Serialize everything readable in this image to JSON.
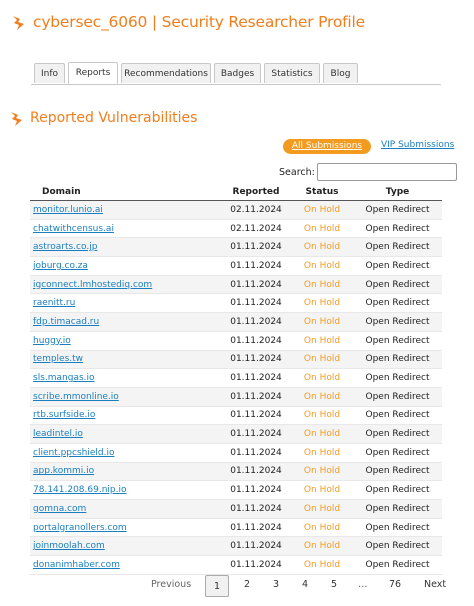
{
  "header": {
    "title": "cybersec_6060 | Security Researcher Profile"
  },
  "tabs": [
    {
      "label": "Info"
    },
    {
      "label": "Reports",
      "active": true
    },
    {
      "label": "Recommendations"
    },
    {
      "label": "Badges"
    },
    {
      "label": "Statistics"
    },
    {
      "label": "Blog"
    }
  ],
  "section": {
    "title": "Reported Vulnerabilities"
  },
  "filters": {
    "all_label": "All Submissions",
    "vip_label": "VIP Submissions"
  },
  "search": {
    "label": "Search:",
    "value": ""
  },
  "table": {
    "headers": {
      "domain": "Domain",
      "reported": "Reported",
      "status": "Status",
      "type": "Type"
    },
    "rows": [
      {
        "domain": "monitor.lunio.ai",
        "reported": "02.11.2024",
        "status": "On Hold",
        "type": "Open Redirect"
      },
      {
        "domain": "chatwithcensus.ai",
        "reported": "02.11.2024",
        "status": "On Hold",
        "type": "Open Redirect"
      },
      {
        "domain": "astroarts.co.jp",
        "reported": "01.11.2024",
        "status": "On Hold",
        "type": "Open Redirect"
      },
      {
        "domain": "joburg.co.za",
        "reported": "01.11.2024",
        "status": "On Hold",
        "type": "Open Redirect"
      },
      {
        "domain": "igconnect.lmhostediq.com",
        "reported": "01.11.2024",
        "status": "On Hold",
        "type": "Open Redirect"
      },
      {
        "domain": "raenitt.ru",
        "reported": "01.11.2024",
        "status": "On Hold",
        "type": "Open Redirect"
      },
      {
        "domain": "fdp.timacad.ru",
        "reported": "01.11.2024",
        "status": "On Hold",
        "type": "Open Redirect"
      },
      {
        "domain": "huggy.io",
        "reported": "01.11.2024",
        "status": "On Hold",
        "type": "Open Redirect"
      },
      {
        "domain": "temples.tw",
        "reported": "01.11.2024",
        "status": "On Hold",
        "type": "Open Redirect"
      },
      {
        "domain": "sls.mangas.io",
        "reported": "01.11.2024",
        "status": "On Hold",
        "type": "Open Redirect"
      },
      {
        "domain": "scribe.mmonline.io",
        "reported": "01.11.2024",
        "status": "On Hold",
        "type": "Open Redirect"
      },
      {
        "domain": "rtb.surfside.io",
        "reported": "01.11.2024",
        "status": "On Hold",
        "type": "Open Redirect"
      },
      {
        "domain": "leadintel.io",
        "reported": "01.11.2024",
        "status": "On Hold",
        "type": "Open Redirect"
      },
      {
        "domain": "client.ppcshield.io",
        "reported": "01.11.2024",
        "status": "On Hold",
        "type": "Open Redirect"
      },
      {
        "domain": "app.kommi.io",
        "reported": "01.11.2024",
        "status": "On Hold",
        "type": "Open Redirect"
      },
      {
        "domain": "78.141.208.69.nip.io",
        "reported": "01.11.2024",
        "status": "On Hold",
        "type": "Open Redirect"
      },
      {
        "domain": "gomna.com",
        "reported": "01.11.2024",
        "status": "On Hold",
        "type": "Open Redirect"
      },
      {
        "domain": "portalgranollers.com",
        "reported": "01.11.2024",
        "status": "On Hold",
        "type": "Open Redirect"
      },
      {
        "domain": "joinmoolah.com",
        "reported": "01.11.2024",
        "status": "On Hold",
        "type": "Open Redirect"
      },
      {
        "domain": "donanimhaber.com",
        "reported": "01.11.2024",
        "status": "On Hold",
        "type": "Open Redirect"
      }
    ]
  },
  "pagination": {
    "previous": "Previous",
    "pages": [
      "1",
      "2",
      "3",
      "4",
      "5",
      "…",
      "76"
    ],
    "current": "1",
    "next": "Next"
  },
  "colors": {
    "accent": "#f07e1c",
    "pill": "#f39b1e",
    "link": "#1a7fc0",
    "status": "#f39b1e"
  }
}
